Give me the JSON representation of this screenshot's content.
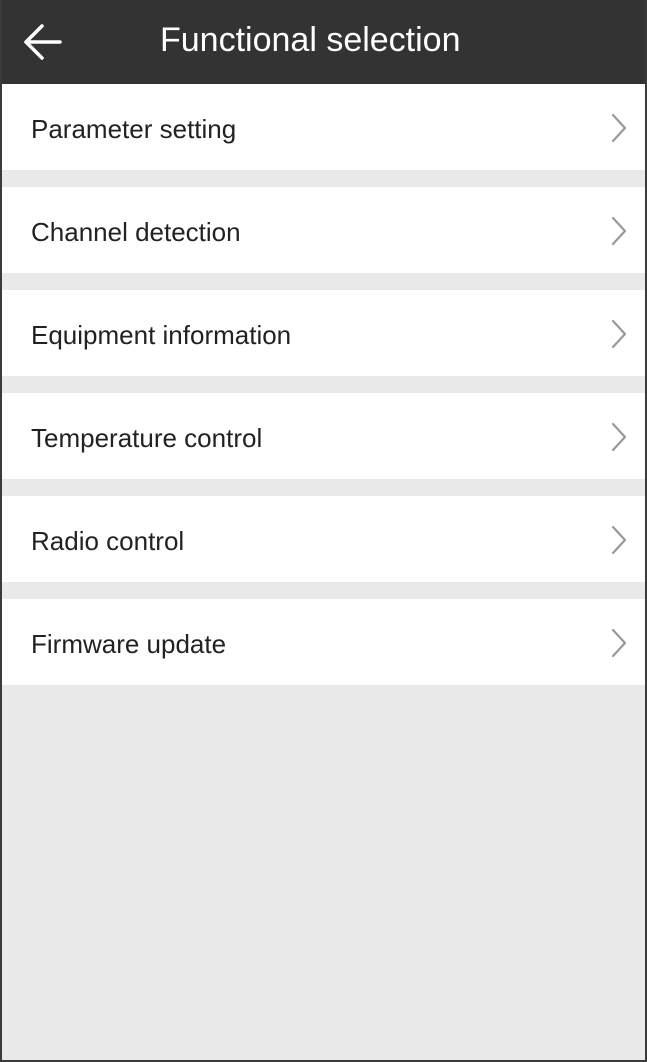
{
  "header": {
    "title": "Functional selection",
    "back_icon": "arrow-left-icon"
  },
  "menu": {
    "items": [
      {
        "label": "Parameter setting",
        "icon": "chevron-right-icon"
      },
      {
        "label": "Channel detection",
        "icon": "chevron-right-icon"
      },
      {
        "label": "Equipment information",
        "icon": "chevron-right-icon"
      },
      {
        "label": "Temperature control",
        "icon": "chevron-right-icon"
      },
      {
        "label": "Radio control",
        "icon": "chevron-right-icon"
      },
      {
        "label": "Firmware update",
        "icon": "chevron-right-icon"
      }
    ]
  },
  "colors": {
    "appbar": "#333333",
    "background": "#e9e9e9",
    "item_background": "#ffffff",
    "chevron": "#999999"
  }
}
